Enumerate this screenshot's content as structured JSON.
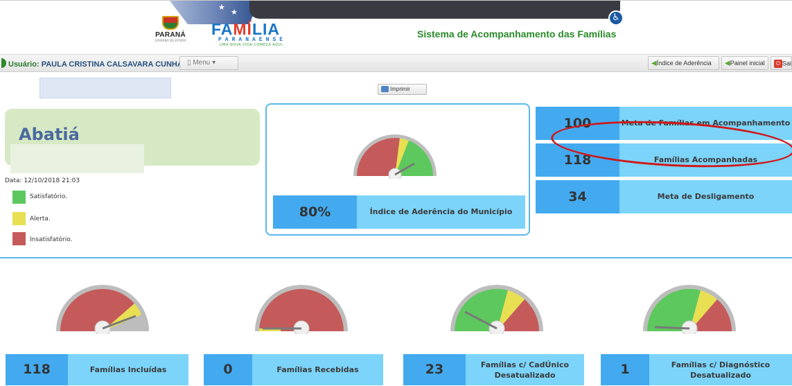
{
  "header": {
    "state_logo": "PARANÁ",
    "state_logo_sub": "GOVERNO DO ESTADO",
    "brand_main": [
      "FA",
      "MÍ",
      "LIA"
    ],
    "brand_sub": "PARANAENSE",
    "brand_tagline": "UMA NOVA VIDA COMEÇA AQUI.",
    "system_title": "Sistema de Acompanhamento das Famílias",
    "accessibility_icon": "accessibility-icon"
  },
  "toolbar": {
    "user_label": "Usuário:",
    "user_name": "PAULA CRISTINA CALSAVARA CUNHA",
    "menu_label": "Menu",
    "buttons": [
      "Índice de Aderência",
      "Painel inicial",
      "Sair"
    ]
  },
  "print_label": "Imprimir",
  "city": "Abatiá",
  "date_text": "Data: 12/10/2018 21:03",
  "legend": [
    {
      "label": "Satisfatório.",
      "color": "#5dc85d"
    },
    {
      "label": "Alerta.",
      "color": "#e8e052"
    },
    {
      "label": "Insatisfatório.",
      "color": "#c55a5a"
    }
  ],
  "adherence": {
    "value": "80%",
    "label": "Índice de Aderência do Município"
  },
  "metrics": [
    {
      "value": "100",
      "label": "Meta de Famílias em Acompanhamento"
    },
    {
      "value": "118",
      "label": "Famílias Acompanhadas"
    },
    {
      "value": "34",
      "label": "Meta de Desligamento"
    }
  ],
  "bottom": [
    {
      "value": "118",
      "label": "Famílias Incluídas"
    },
    {
      "value": "0",
      "label": "Famílias Recebidas"
    },
    {
      "value": "23",
      "label": "Famílias c/ CadÚnico Desatualizado"
    },
    {
      "value": "1",
      "label": "Famílias c/ Diagnóstico Desatualizado"
    }
  ],
  "colors": {
    "green": "#5dc85d",
    "yellow": "#e8e052",
    "red": "#c55a5a",
    "accent_blue": "#43aaf0",
    "light_blue": "#7cd4fa"
  }
}
